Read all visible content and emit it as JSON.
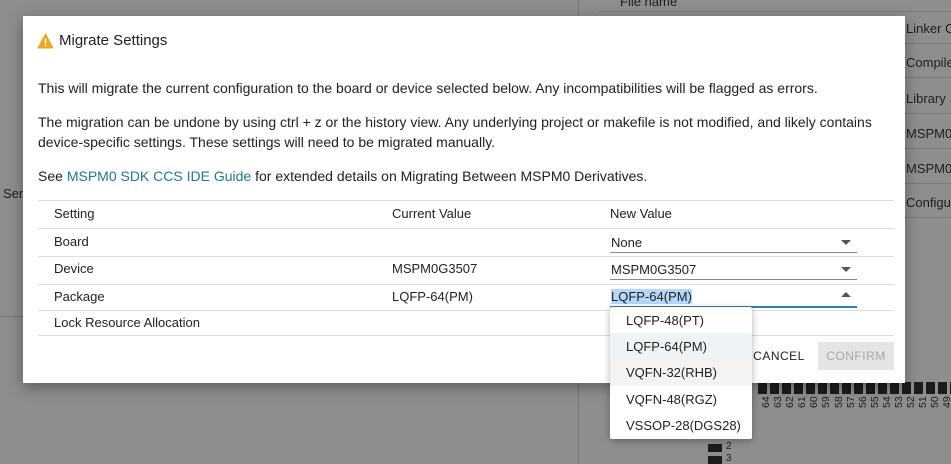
{
  "background": {
    "header_label": "File name",
    "categories": [
      "Linker C",
      "Compile",
      "Library",
      "MSPM0",
      "MSPM0",
      "Configu"
    ],
    "left_label": "Sen",
    "pin_numbers": [
      "64",
      "63",
      "62",
      "61",
      "60",
      "59",
      "58",
      "57",
      "56",
      "55",
      "54",
      "53",
      "52",
      "51",
      "50",
      "49"
    ],
    "pin_side_numbers": [
      "2",
      "3"
    ]
  },
  "dialog": {
    "title": "Migrate Settings",
    "paragraph1": "This will migrate the current configuration to the board or device selected below. Any incompatibilities will be flagged as errors.",
    "paragraph2": "The migration can be undone by using ctrl + z or the history view. Any underlying project or makefile is not modified, and likely contains device-specific settings. These settings will need to be migrated manually.",
    "paragraph3_prefix": "See ",
    "paragraph3_link": "MSPM0 SDK CCS IDE Guide",
    "paragraph3_suffix": " for extended details on Migrating Between MSPM0 Derivatives.",
    "table": {
      "headers": [
        "Setting",
        "Current Value",
        "New Value"
      ],
      "rows": [
        {
          "setting": "Board",
          "current": "",
          "new": "None"
        },
        {
          "setting": "Device",
          "current": "MSPM0G3507",
          "new": "MSPM0G3507"
        },
        {
          "setting": "Package",
          "current": "LQFP-64(PM)",
          "new": "LQFP-64(PM)"
        },
        {
          "setting": "Lock Resource Allocation",
          "current": "",
          "new": ""
        }
      ]
    },
    "buttons": {
      "cancel": "CANCEL",
      "confirm": "CONFIRM"
    },
    "package_dropdown": {
      "options": [
        "LQFP-48(PT)",
        "LQFP-64(PM)",
        "VQFN-32(RHB)",
        "VQFN-48(RGZ)",
        "VSSOP-28(DGS28)"
      ],
      "selected": "LQFP-64(PM)",
      "hovered": "VQFN-32(RHB)"
    }
  },
  "colors": {
    "link": "#1e7a88",
    "focus": "#2d7fc0",
    "warning": "#f2a51e"
  }
}
